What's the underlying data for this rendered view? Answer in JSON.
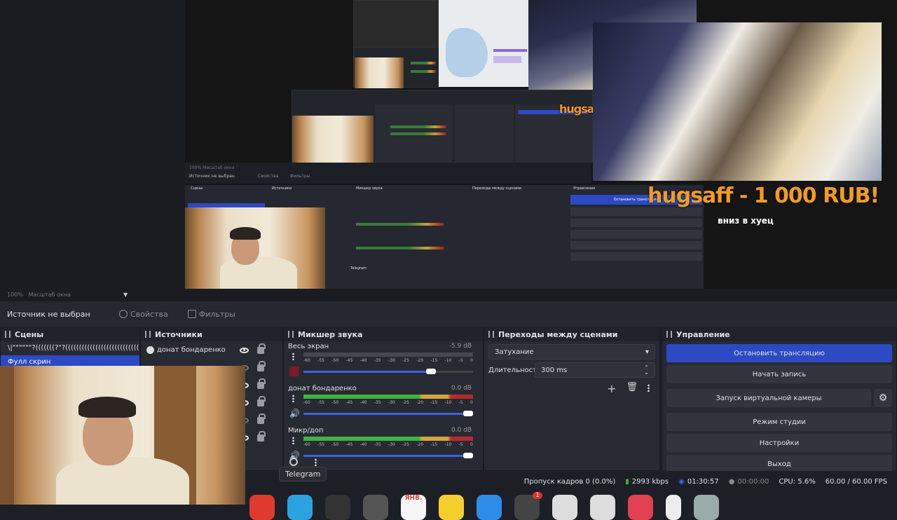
{
  "preview": {
    "donation_name": "hugsaff - 1 000 RUB!",
    "donation_message": "вниз в хуец",
    "small_donation_tag": "hugsaf",
    "nested_source_label": "Источник не выбран",
    "nested_properties": "Свойства",
    "nested_filters": "Фильтры",
    "nested_scenes": "Сцены",
    "nested_sources": "Источники",
    "nested_mixer": "Микшер звука",
    "nested_transitions": "Переходы между сценами",
    "nested_controls": "Управление",
    "nested_stop": "Остановить трансляцию",
    "nested_telegram": "Telegram"
  },
  "zoom": {
    "value": "100%",
    "label": "Масштаб окна"
  },
  "source_bar": {
    "no_source": "Источник не выбран",
    "properties": "Свойства",
    "filters": "Фильтры"
  },
  "scenes": {
    "title": "Сцены",
    "items": [
      {
        "label": "\\|\"\"\"\"\"\"?(((((((?\"?((((((((((((((((((((((((((((((((((((((((((((((((?",
        "selected": false
      },
      {
        "label": "Фулл скрин",
        "selected": true
      }
    ]
  },
  "sources": {
    "title": "Источники",
    "items": [
      {
        "label": "донат бондаренко",
        "visible": true
      },
      {
        "label": "",
        "visible": false
      },
      {
        "label": "",
        "visible": true
      },
      {
        "label": "",
        "visible": true
      },
      {
        "label": "",
        "visible": false
      },
      {
        "label": "",
        "visible": true
      }
    ]
  },
  "mixer": {
    "title": "Микшер звука",
    "ticks": [
      "-60",
      "-55",
      "-50",
      "-45",
      "-40",
      "-35",
      "-30",
      "-25",
      "-20",
      "-15",
      "-10",
      "-5",
      "0"
    ],
    "channels": [
      {
        "name": "Весь экран",
        "db": "-5.9 dB",
        "level": 0.0,
        "volume": 0.78,
        "muted": true
      },
      {
        "name": "донат бондаренко",
        "db": "0.0 dB",
        "level": 1.0,
        "volume": 1.0,
        "muted": false
      },
      {
        "name": "Микр/доп",
        "db": "0.0 dB",
        "level": 1.0,
        "volume": 1.0,
        "muted": false
      }
    ]
  },
  "transitions": {
    "title": "Переходы между сценами",
    "type": "Затухание",
    "duration_label": "Длительность",
    "duration_value": "300 ms"
  },
  "controls": {
    "title": "Управление",
    "stop_stream": "Остановить трансляцию",
    "start_record": "Начать запись",
    "virtual_cam": "Запуск виртуальной камеры",
    "studio_mode": "Режим студии",
    "settings": "Настройки",
    "exit": "Выход"
  },
  "tooltip": "Telegram",
  "status": {
    "dropped": "Пропуск кадров 0 (0.0%)",
    "bitrate": "2993 kbps",
    "stream_time": "01:30:57",
    "rec_time": "00:00:00",
    "cpu": "CPU: 5.6%",
    "fps": "60.00 / 60.00 FPS"
  },
  "dock": {
    "calendar_month": "ЯНВ.",
    "badge": "1"
  },
  "colors": {
    "accent": "#2d4ac4",
    "donation": "#f39b1e",
    "meter_green": "#3fb33f",
    "meter_yellow": "#d6a43c",
    "meter_red": "#b82a2a"
  }
}
